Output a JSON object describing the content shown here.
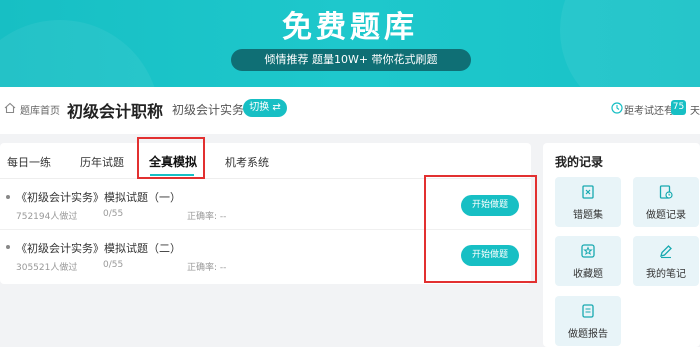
{
  "banner": {
    "title": "免费题库",
    "pill": "倾情推荐 题量10W+ 带你花式刷题"
  },
  "crumbbar": {
    "crumb": "题库首页",
    "title": "初级会计职称",
    "subject": "初级会计实务",
    "switch_label": "切换 ⇄",
    "exam_label": "距考试还有",
    "days": "75",
    "days_unit": "天"
  },
  "tabs": [
    {
      "label": "每日一练"
    },
    {
      "label": "历年试题"
    },
    {
      "label": "全真模拟"
    },
    {
      "label": "机考系统"
    }
  ],
  "items": [
    {
      "title": "《初级会计实务》模拟试题（一）",
      "count": "752194人做过",
      "progress": "0/55",
      "accuracy": "正确率: --",
      "button": "开始做题"
    },
    {
      "title": "《初级会计实务》模拟试题（二）",
      "count": "305521人做过",
      "progress": "0/55",
      "accuracy": "正确率: --",
      "button": "开始做题"
    }
  ],
  "records": {
    "title": "我的记录",
    "cards": [
      {
        "label": "错题集",
        "icon": "wrong-book-icon"
      },
      {
        "label": "做题记录",
        "icon": "record-icon"
      },
      {
        "label": "收藏题",
        "icon": "star-icon"
      },
      {
        "label": "我的笔记",
        "icon": "pen-icon"
      },
      {
        "label": "做题报告",
        "icon": "report-icon"
      }
    ]
  },
  "colors": {
    "accent": "#17bfc4",
    "highlight": "#e23030",
    "pill": "#0f6f75"
  }
}
